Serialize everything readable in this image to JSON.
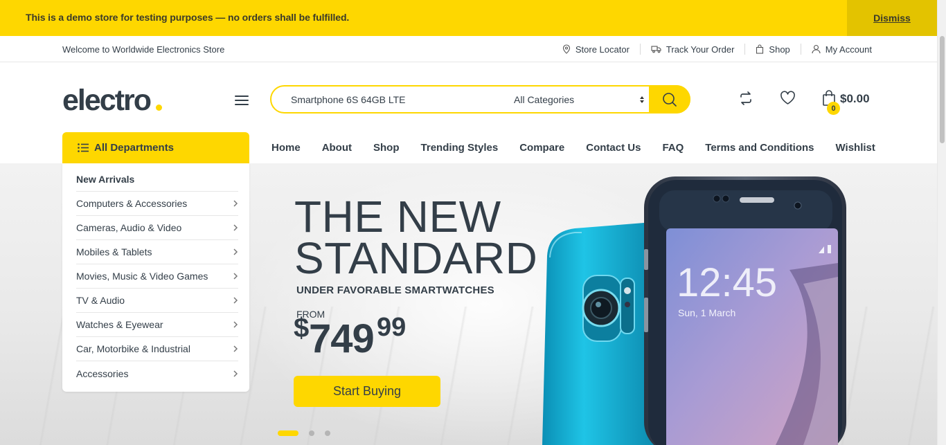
{
  "demo_notice": {
    "text": "This is a demo store for testing purposes — no orders shall be fulfilled.",
    "dismiss_label": "Dismiss"
  },
  "topbar": {
    "welcome": "Welcome to Worldwide Electronics Store",
    "links": [
      {
        "label": "Store Locator",
        "icon": "map-pin-icon"
      },
      {
        "label": "Track Your Order",
        "icon": "truck-icon"
      },
      {
        "label": "Shop",
        "icon": "shopping-bag-icon"
      },
      {
        "label": "My Account",
        "icon": "user-icon"
      }
    ]
  },
  "header": {
    "logo": "electro",
    "search_value": "Smartphone 6S 64GB LTE",
    "category_selected": "All Categories",
    "cart_count": "0",
    "cart_total": "$0.00"
  },
  "departments": {
    "button_label": "All Departments",
    "items": [
      "New Arrivals",
      "Computers & Accessories",
      "Cameras, Audio & Video",
      "Mobiles & Tablets",
      "Movies, Music & Video Games",
      "TV & Audio",
      "Watches & Eyewear",
      "Car, Motorbike & Industrial",
      "Accessories"
    ]
  },
  "nav": [
    "Home",
    "About",
    "Shop",
    "Trending Styles",
    "Compare",
    "Contact Us",
    "FAQ",
    "Terms and Conditions",
    "Wishlist"
  ],
  "hero": {
    "title_line1": "THE NEW",
    "title_line2": "STANDARD",
    "subtitle": "UNDER FAVORABLE SMARTWATCHES",
    "from_label": "FROM",
    "price_currency": "$",
    "price_integer": "749",
    "price_decimal": "99",
    "cta_label": "Start Buying",
    "phone_time": "12:45",
    "phone_date": "Sun, 1 March",
    "slide_count": 3,
    "active_slide": 1
  },
  "colors": {
    "accent": "#fed700",
    "text": "#333e48"
  }
}
